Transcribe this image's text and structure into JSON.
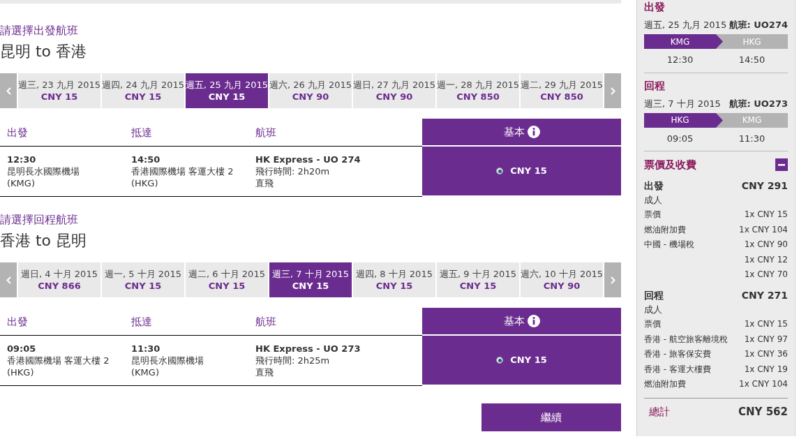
{
  "sections": [
    {
      "prompt": "請選擇出發航班",
      "route": "昆明 to 香港",
      "dates": [
        {
          "day": "週三, 23 九月 2015",
          "price": "CNY 15",
          "selected": false
        },
        {
          "day": "週四, 24 九月 2015",
          "price": "CNY 15",
          "selected": false
        },
        {
          "day": "週五, 25 九月 2015",
          "price": "CNY 15",
          "selected": true
        },
        {
          "day": "週六, 26 九月 2015",
          "price": "CNY 90",
          "selected": false
        },
        {
          "day": "週日, 27 九月 2015",
          "price": "CNY 90",
          "selected": false
        },
        {
          "day": "週一, 28 九月 2015",
          "price": "CNY 850",
          "selected": false
        },
        {
          "day": "週二, 29 九月 2015",
          "price": "CNY 850",
          "selected": false
        }
      ],
      "columns": [
        "出發",
        "抵達",
        "航班"
      ],
      "fare_class": "基本",
      "flight": {
        "depart_time": "12:30",
        "depart_airport": "昆明長水國際機場",
        "depart_code": "(KMG)",
        "arrive_time": "14:50",
        "arrive_airport": "香港國際機場 客運大樓 2",
        "arrive_code": "(HKG)",
        "carrier": "HK Express - UO 274",
        "duration": "飛行時間: 2h20m",
        "stops": "直飛",
        "fare": "CNY 15",
        "selected": true
      }
    },
    {
      "prompt": "請選擇回程航班",
      "route": "香港 to 昆明",
      "dates": [
        {
          "day": "週日, 4 十月 2015",
          "price": "CNY 866",
          "selected": false
        },
        {
          "day": "週一, 5 十月 2015",
          "price": "CNY 15",
          "selected": false
        },
        {
          "day": "週二, 6 十月 2015",
          "price": "CNY 15",
          "selected": false
        },
        {
          "day": "週三, 7 十月 2015",
          "price": "CNY 15",
          "selected": true
        },
        {
          "day": "週四, 8 十月 2015",
          "price": "CNY 15",
          "selected": false
        },
        {
          "day": "週五, 9 十月 2015",
          "price": "CNY 15",
          "selected": false
        },
        {
          "day": "週六, 10 十月 2015",
          "price": "CNY 90",
          "selected": false
        }
      ],
      "columns": [
        "出發",
        "抵達",
        "航班"
      ],
      "fare_class": "基本",
      "flight": {
        "depart_time": "09:05",
        "depart_airport": "香港國際機場 客運大樓 2",
        "depart_code": "(HKG)",
        "arrive_time": "11:30",
        "arrive_airport": "昆明長水國際機場",
        "arrive_code": "(KMG)",
        "carrier": "HK Express - UO 273",
        "duration": "飛行時間: 2h25m",
        "stops": "直飛",
        "fare": "CNY 15",
        "selected": true
      }
    }
  ],
  "continue_button": "繼續",
  "summary": {
    "legs": [
      {
        "title": "出發",
        "date": "週五, 25 九月 2015",
        "flight": "航班: UO274",
        "from": "KMG",
        "to": "HKG",
        "depart": "12:30",
        "arrive": "14:50"
      },
      {
        "title": "回程",
        "date": "週三, 7 十月 2015",
        "flight": "航班: UO273",
        "from": "HKG",
        "to": "KMG",
        "depart": "09:05",
        "arrive": "11:30"
      }
    ],
    "fees": {
      "title": "票價及收費",
      "expanded": true,
      "groups": [
        {
          "title": "出發",
          "total": "CNY 291",
          "passenger": "成人",
          "items": [
            {
              "label": "票價",
              "amount": "1x CNY 15"
            },
            {
              "label": "燃油附加費",
              "amount": "1x CNY 104"
            },
            {
              "label": "中國 - 機場稅",
              "amount": "1x CNY 90"
            },
            {
              "amount": "1x CNY 12"
            },
            {
              "amount": "1x CNY 70"
            }
          ]
        },
        {
          "title": "回程",
          "total": "CNY 271",
          "passenger": "成人",
          "items": [
            {
              "label": "票價",
              "amount": "1x CNY 15"
            },
            {
              "label": "香港 - 航空旅客離境稅",
              "amount": "1x CNY 97"
            },
            {
              "label": "香港 - 旅客保安費",
              "amount": "1x CNY 36"
            },
            {
              "label": "香港 - 客運大樓費",
              "amount": "1x CNY 19"
            },
            {
              "label": "燃油附加費",
              "amount": "1x CNY 104"
            }
          ]
        }
      ]
    },
    "total": {
      "label": "總計",
      "amount": "CNY 562"
    }
  }
}
